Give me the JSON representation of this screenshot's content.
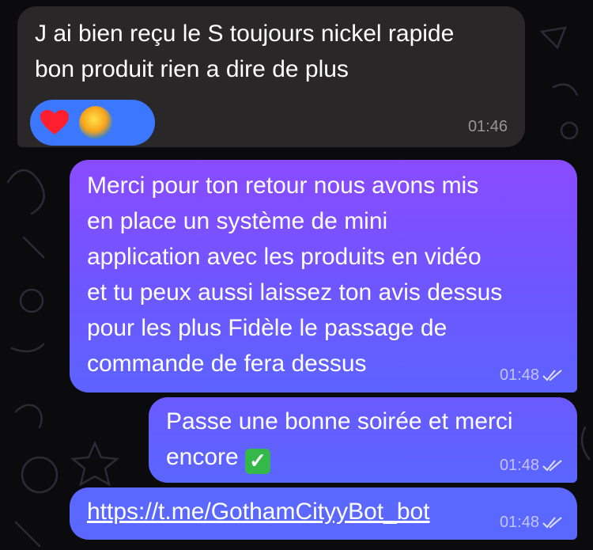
{
  "chat": {
    "messages": [
      {
        "direction": "incoming",
        "text": "J ai bien reçu le S toujours nickel rapide\nbon produit rien a dire de plus",
        "time": "01:46",
        "reactions": [
          {
            "icon": "heart-icon",
            "emoji": "❤️"
          },
          {
            "icon": "sticker-avatar-icon"
          }
        ]
      },
      {
        "direction": "outgoing",
        "text": "Merci pour ton retour nous avons mis\nen place un système de mini\napplication avec les produits en vidéo\net tu peux aussi laissez ton avis dessus\npour les plus Fidèle le passage de\ncommande de fera dessus",
        "time": "01:48",
        "status": "read"
      },
      {
        "direction": "outgoing",
        "text": "Passe une bonne soirée et merci\nencore",
        "emoji": "✓",
        "time": "01:48",
        "status": "read"
      },
      {
        "direction": "outgoing",
        "link": "https://t.me/GothamCityyBot_bot",
        "time": "01:48",
        "status": "read"
      }
    ]
  },
  "colors": {
    "background": "#0b0b0d",
    "incoming_bubble": "#2a2729",
    "outgoing_top": "#8a4bff",
    "outgoing_bottom": "#5a68ff",
    "reaction_pill": "#3b78ff"
  }
}
